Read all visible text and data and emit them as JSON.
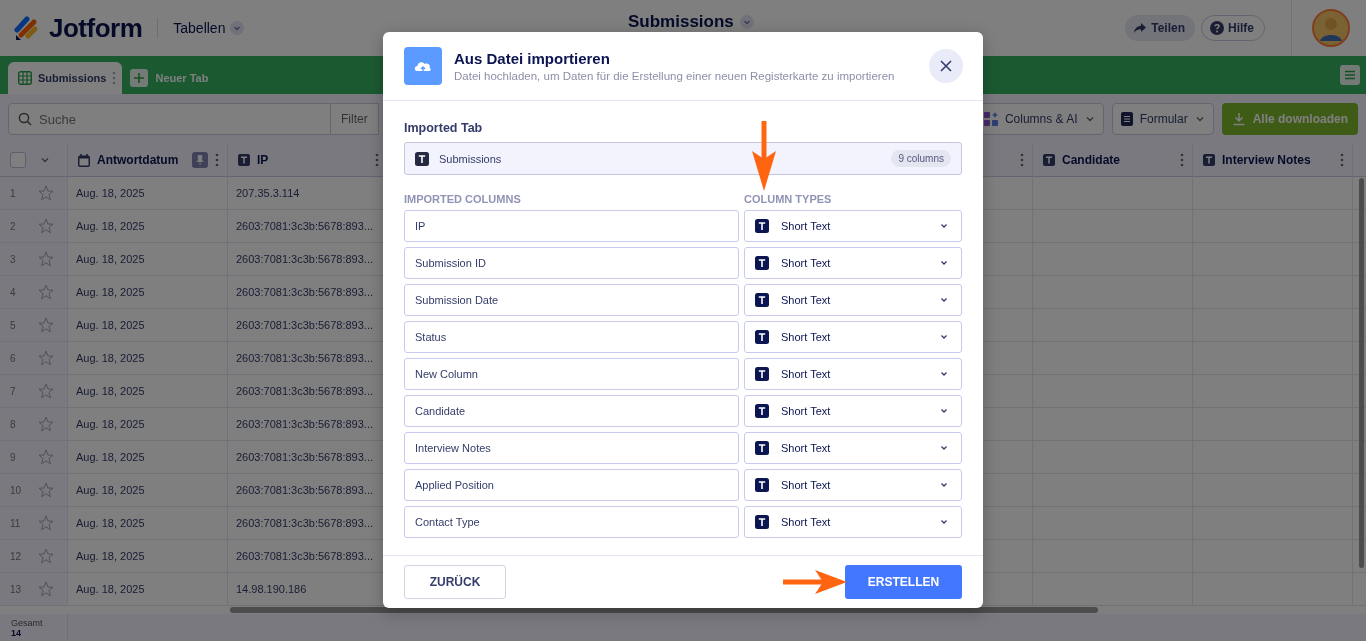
{
  "header": {
    "brand": "Jotform",
    "section": "Tabellen",
    "title": "Submissions",
    "share": "Teilen",
    "help": "Hilfe"
  },
  "tabs": [
    {
      "label": "Submissions",
      "selected": true
    }
  ],
  "new_tab": "Neuer Tab",
  "toolbar": {
    "search_placeholder": "Suche",
    "filter": "Filter",
    "columns_ai": "Columns & AI",
    "form": "Formular",
    "download": "Alle downloaden"
  },
  "table": {
    "columns": [
      {
        "label": "Antwortdatum",
        "kind": "date",
        "pinned": true
      },
      {
        "label": "IP",
        "kind": "text",
        "pinned": false
      },
      {
        "label": "Candidate",
        "kind": "text",
        "pinned": false
      },
      {
        "label": "Interview Notes",
        "kind": "text",
        "pinned": false
      }
    ],
    "all_selected": false,
    "rows": [
      {
        "number": "1",
        "starred": false,
        "date": "Aug. 18, 2025",
        "ip": "207.35.3.114"
      },
      {
        "number": "2",
        "starred": false,
        "date": "Aug. 18, 2025",
        "ip": "2603:7081:3c3b:5678:893..."
      },
      {
        "number": "3",
        "starred": false,
        "date": "Aug. 18, 2025",
        "ip": "2603:7081:3c3b:5678:893..."
      },
      {
        "number": "4",
        "starred": false,
        "date": "Aug. 18, 2025",
        "ip": "2603:7081:3c3b:5678:893..."
      },
      {
        "number": "5",
        "starred": false,
        "date": "Aug. 18, 2025",
        "ip": "2603:7081:3c3b:5678:893..."
      },
      {
        "number": "6",
        "starred": false,
        "date": "Aug. 18, 2025",
        "ip": "2603:7081:3c3b:5678:893..."
      },
      {
        "number": "7",
        "starred": false,
        "date": "Aug. 18, 2025",
        "ip": "2603:7081:3c3b:5678:893..."
      },
      {
        "number": "8",
        "starred": false,
        "date": "Aug. 18, 2025",
        "ip": "2603:7081:3c3b:5678:893..."
      },
      {
        "number": "9",
        "starred": false,
        "date": "Aug. 18, 2025",
        "ip": "2603:7081:3c3b:5678:893..."
      },
      {
        "number": "10",
        "starred": false,
        "date": "Aug. 18, 2025",
        "ip": "2603:7081:3c3b:5678:893..."
      },
      {
        "number": "11",
        "starred": false,
        "date": "Aug. 18, 2025",
        "ip": "2603:7081:3c3b:5678:893..."
      },
      {
        "number": "12",
        "starred": false,
        "date": "Aug. 18, 2025",
        "ip": "2603:7081:3c3b:5678:893..."
      },
      {
        "number": "13",
        "starred": false,
        "date": "Aug. 18, 2025",
        "ip": "14.98.190.186"
      }
    ],
    "total_label": "Gesamt",
    "total": "14"
  },
  "dialog": {
    "title": "Aus Datei importieren",
    "subtitle": "Datei hochladen, um Daten für die Erstellung einer neuen Registerkarte zu importieren",
    "imported_tab_label": "Imported Tab",
    "imported_tab": "Submissions",
    "column_count": "9 columns",
    "columns_heading": "IMPORTED COLUMNS",
    "types_heading": "COLUMN TYPES",
    "columns": [
      {
        "name": "IP",
        "type": "Short Text"
      },
      {
        "name": "Submission ID",
        "type": "Short Text"
      },
      {
        "name": "Submission Date",
        "type": "Short Text"
      },
      {
        "name": "Status",
        "type": "Short Text"
      },
      {
        "name": "New Column",
        "type": "Short Text"
      },
      {
        "name": "Candidate",
        "type": "Short Text"
      },
      {
        "name": "Interview Notes",
        "type": "Short Text"
      },
      {
        "name": "Applied Position",
        "type": "Short Text"
      },
      {
        "name": "Contact Type",
        "type": "Short Text"
      }
    ],
    "back": "ZURÜCK",
    "create": "ERSTELLEN"
  }
}
